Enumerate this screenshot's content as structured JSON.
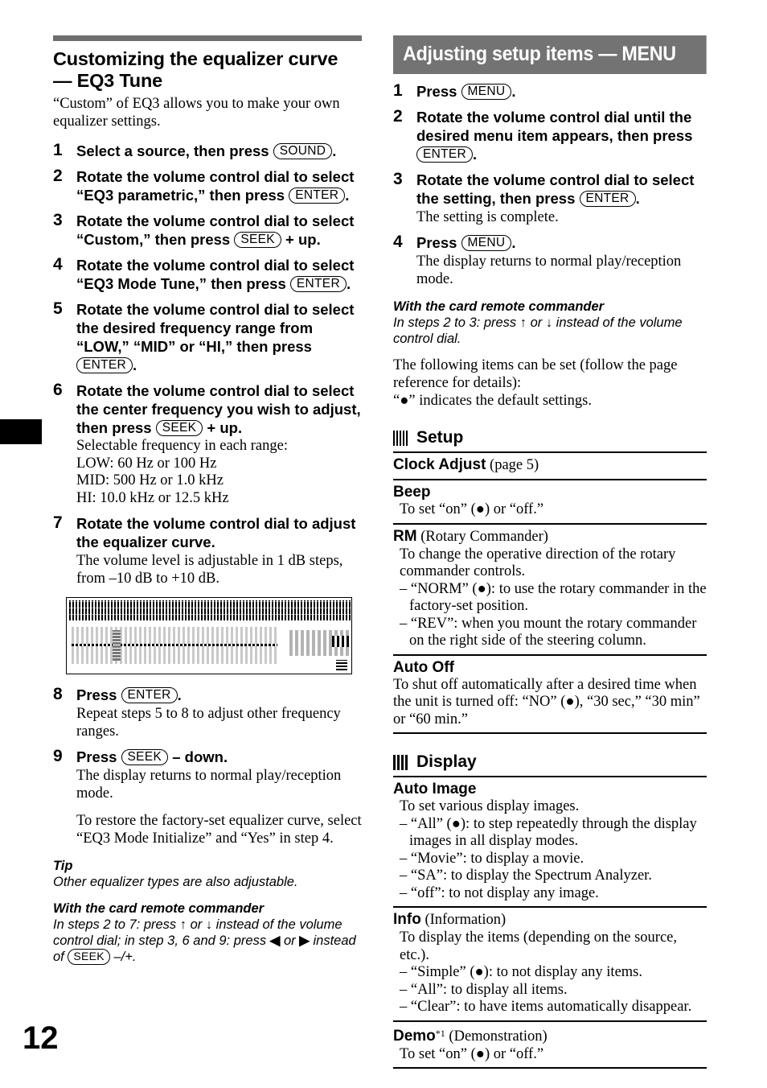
{
  "page": {
    "number": "12"
  },
  "left": {
    "title_line1": "Customizing the equalizer curve",
    "title_line2": "— EQ3 Tune",
    "intro": "“Custom” of EQ3 allows you to make your own equalizer settings.",
    "steps": [
      {
        "num": "1",
        "head_a": "Select a source, then press ",
        "key": "SOUND",
        "head_b": ".",
        "body": ""
      },
      {
        "num": "2",
        "head_a": "Rotate the volume control dial to select “EQ3 parametric,” then press ",
        "key": "ENTER",
        "head_b": ".",
        "body": ""
      },
      {
        "num": "3",
        "head_a": "Rotate the volume control dial to select “Custom,” then press ",
        "key": "SEEK",
        "head_b": " + up.",
        "body": ""
      },
      {
        "num": "4",
        "head_a": "Rotate the volume control dial to select “EQ3 Mode Tune,” then press ",
        "key": "ENTER",
        "head_b": ".",
        "body": ""
      },
      {
        "num": "5",
        "head_a": "Rotate the volume control dial to select the desired frequency range from “LOW,” “MID” or “HI,” then press ",
        "key": "ENTER",
        "head_b": ".",
        "body": ""
      },
      {
        "num": "6",
        "head_a": "Rotate the volume control dial to select the center frequency you wish to adjust, then press ",
        "key": "SEEK",
        "head_b": " + up.",
        "body_lines": [
          "Selectable frequency in each range:",
          "LOW: 60 Hz or 100 Hz",
          "MID: 500 Hz or 1.0 kHz",
          "HI: 10.0 kHz or 12.5 kHz"
        ]
      },
      {
        "num": "7",
        "head_a": "Rotate the volume control dial to adjust the equalizer curve.",
        "key": "",
        "head_b": "",
        "body_lines": [
          "The volume level is adjustable in 1 dB steps, from –10 dB to +10 dB."
        ]
      },
      {
        "num": "8",
        "head_a": "Press ",
        "key": "ENTER",
        "head_b": ".",
        "body_lines": [
          "Repeat steps 5 to 8 to adjust other frequency ranges."
        ]
      },
      {
        "num": "9",
        "head_a": "Press ",
        "key": "SEEK",
        "head_b": " – down.",
        "body_lines": [
          "The display returns to normal play/reception mode."
        ],
        "body2": "To restore the factory-set equalizer curve, select “EQ3 Mode Initialize” and “Yes” in step 4."
      }
    ],
    "tip_title": "Tip",
    "tip_body": "Other equalizer types are also adjustable.",
    "remote_title": "With the card remote commander",
    "remote_body_a": "In steps 2 to 7: press ",
    "remote_up": "↑",
    "remote_or1": " or ",
    "remote_down": "↓",
    "remote_body_b": " instead of the volume control dial; in step 3, 6 and 9: press ",
    "remote_left": "◀",
    "remote_or2": " or ",
    "remote_right": "▶",
    "remote_body_c": " instead of ",
    "remote_key": "SEEK",
    "remote_body_d": " –/+."
  },
  "right": {
    "banner": "Adjusting setup items — MENU",
    "steps": [
      {
        "num": "1",
        "head_a": "Press ",
        "key": "MENU",
        "head_b": ".",
        "body": ""
      },
      {
        "num": "2",
        "head_a": "Rotate the volume control dial until the desired menu item appears, then press ",
        "key": "ENTER",
        "head_b": ".",
        "body": ""
      },
      {
        "num": "3",
        "head_a": "Rotate the volume control dial to select the setting, then press ",
        "key": "ENTER",
        "head_b": ".",
        "body": "The setting is complete."
      },
      {
        "num": "4",
        "head_a": "Press ",
        "key": "MENU",
        "head_b": ".",
        "body": "The display returns to normal play/reception mode."
      }
    ],
    "remote_title": "With the card remote commander",
    "remote_body_a": "In steps 2 to 3: press ",
    "remote_up": "↑",
    "remote_or": " or ",
    "remote_down": "↓",
    "remote_body_b": " instead of the volume control dial.",
    "lead_para": "The following items can be set (follow the page reference for details):",
    "default_note_a": "“",
    "default_note_dot": "●",
    "default_note_b": "” indicates the default settings.",
    "groups": [
      {
        "icon": "setup-icon",
        "label": "Setup",
        "entries": [
          {
            "title": "Clock Adjust",
            "paren": " (page 5)",
            "lines": []
          },
          {
            "title": "Beep",
            "paren": "",
            "lines": [
              "To set “on” (●) or “off.”"
            ]
          },
          {
            "title": "RM",
            "paren": " (Rotary Commander)",
            "lines": [
              "To change the operative direction of the rotary commander controls."
            ],
            "bullets": [
              "– “NORM” (●): to use the rotary commander in the factory-set position.",
              "– “REV”: when you mount the rotary commander on the right side of the steering column."
            ]
          },
          {
            "title": "Auto Off",
            "paren": "",
            "lines_nopad": [
              "To shut off automatically after a desired time when the unit is turned off: “NO” (●), “30 sec,” “30 min” or “60 min.”"
            ]
          }
        ]
      },
      {
        "icon": "display-icon",
        "label": "Display",
        "entries": [
          {
            "title": "Auto Image",
            "paren": "",
            "lines": [
              "To set various display images."
            ],
            "bullets": [
              "– “All” (●): to step repeatedly through the display images in all display modes.",
              "– “Movie”: to display a movie.",
              "– “SA”: to display the Spectrum Analyzer.",
              "– “off”: to not display any image."
            ]
          },
          {
            "title": "Info",
            "paren": " (Information)",
            "lines": [
              "To display the items (depending on the source, etc.)."
            ],
            "bullets": [
              "– “Simple” (●): to not display any items.",
              "– “All”: to display all items.",
              "– “Clear”: to have items automatically disappear."
            ]
          },
          {
            "title": "Demo",
            "sup": "*1",
            "paren": " (Demonstration)",
            "lines": [
              "To set “on” (●) or “off.”"
            ]
          }
        ]
      }
    ]
  },
  "colors": {
    "banner_bg": "#737373",
    "rule": "#6e6e6e",
    "text": "#000000"
  }
}
